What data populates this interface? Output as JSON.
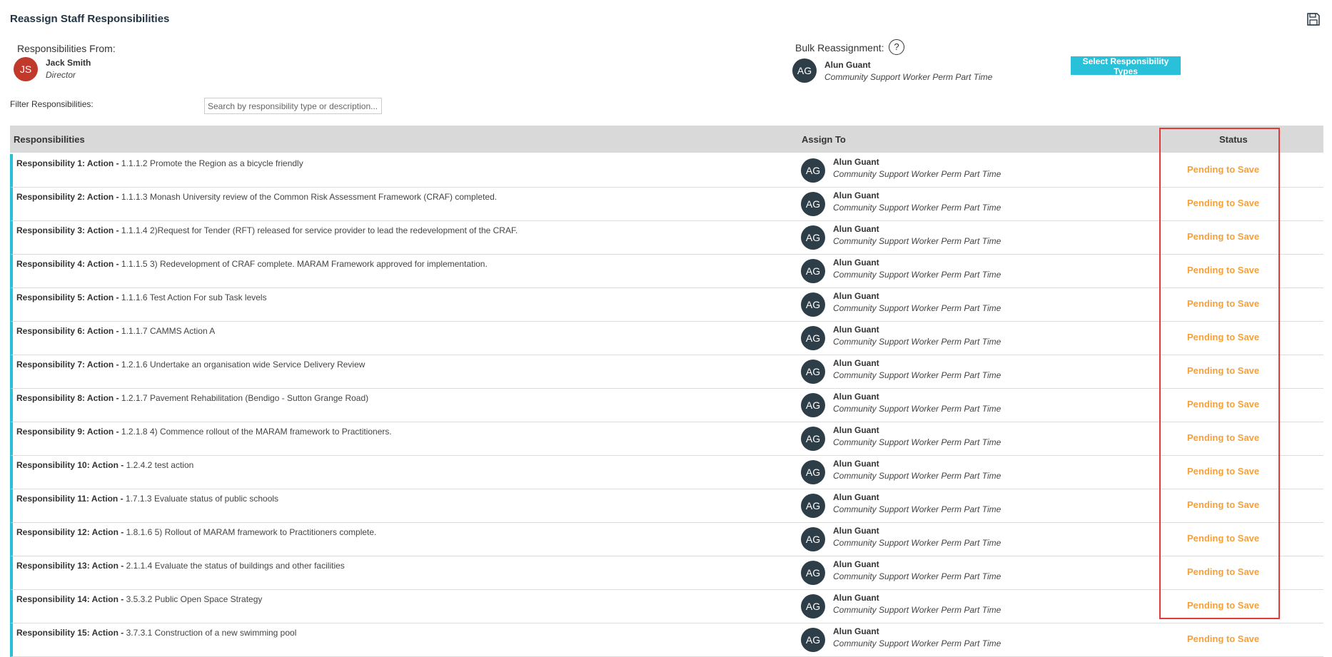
{
  "page": {
    "title": "Reassign Staff Responsibilities"
  },
  "from": {
    "label": "Responsibilities From:",
    "initials": "JS",
    "name": "Jack Smith",
    "role": "Director"
  },
  "bulk": {
    "label": "Bulk Reassignment:",
    "help": "?",
    "initials": "AG",
    "name": "Alun Guant",
    "role": "Community Support Worker Perm Part Time",
    "button_label": "Select Responsibility Types"
  },
  "filter": {
    "label": "Filter Responsibilities:",
    "placeholder": "Search by responsibility type or description..."
  },
  "table": {
    "headers": {
      "responsibilities": "Responsibilities",
      "assign_to": "Assign To",
      "status": "Status"
    },
    "rows": [
      {
        "prefix": "Responsibility 1: Action -",
        "text": " 1.1.1.2 Promote the Region as a bicycle friendly",
        "initials": "AG",
        "name": "Alun Guant",
        "role": "Community Support Worker Perm Part Time",
        "status": "Pending to Save"
      },
      {
        "prefix": "Responsibility 2: Action -",
        "text": " 1.1.1.3 Monash University review of the Common Risk Assessment Framework (CRAF) completed.",
        "initials": "AG",
        "name": "Alun Guant",
        "role": "Community Support Worker Perm Part Time",
        "status": "Pending to Save"
      },
      {
        "prefix": "Responsibility 3: Action -",
        "text": " 1.1.1.4 2)Request for Tender (RFT) released for service provider to lead the redevelopment of the CRAF.",
        "initials": "AG",
        "name": "Alun Guant",
        "role": "Community Support Worker Perm Part Time",
        "status": "Pending to Save"
      },
      {
        "prefix": "Responsibility 4: Action -",
        "text": " 1.1.1.5 3) Redevelopment of CRAF complete. MARAM Framework approved for implementation.",
        "initials": "AG",
        "name": "Alun Guant",
        "role": "Community Support Worker Perm Part Time",
        "status": "Pending to Save"
      },
      {
        "prefix": "Responsibility 5: Action -",
        "text": " 1.1.1.6 Test Action For sub Task levels",
        "initials": "AG",
        "name": "Alun Guant",
        "role": "Community Support Worker Perm Part Time",
        "status": "Pending to Save"
      },
      {
        "prefix": "Responsibility 6: Action -",
        "text": " 1.1.1.7 CAMMS Action A",
        "initials": "AG",
        "name": "Alun Guant",
        "role": "Community Support Worker Perm Part Time",
        "status": "Pending to Save"
      },
      {
        "prefix": "Responsibility 7: Action -",
        "text": " 1.2.1.6 Undertake an organisation wide Service Delivery Review",
        "initials": "AG",
        "name": "Alun Guant",
        "role": "Community Support Worker Perm Part Time",
        "status": "Pending to Save"
      },
      {
        "prefix": "Responsibility 8: Action -",
        "text": " 1.2.1.7 Pavement Rehabilitation (Bendigo - Sutton Grange Road)",
        "initials": "AG",
        "name": "Alun Guant",
        "role": "Community Support Worker Perm Part Time",
        "status": "Pending to Save"
      },
      {
        "prefix": "Responsibility 9: Action -",
        "text": " 1.2.1.8 4) Commence rollout of the MARAM framework to Practitioners.",
        "initials": "AG",
        "name": "Alun Guant",
        "role": "Community Support Worker Perm Part Time",
        "status": "Pending to Save"
      },
      {
        "prefix": "Responsibility 10: Action -",
        "text": " 1.2.4.2 test action",
        "initials": "AG",
        "name": "Alun Guant",
        "role": "Community Support Worker Perm Part Time",
        "status": "Pending to Save"
      },
      {
        "prefix": "Responsibility 11: Action -",
        "text": " 1.7.1.3 Evaluate status of public schools",
        "initials": "AG",
        "name": "Alun Guant",
        "role": "Community Support Worker Perm Part Time",
        "status": "Pending to Save"
      },
      {
        "prefix": "Responsibility 12: Action -",
        "text": " 1.8.1.6 5) Rollout of MARAM framework to Practitioners complete.",
        "initials": "AG",
        "name": "Alun Guant",
        "role": "Community Support Worker Perm Part Time",
        "status": "Pending to Save"
      },
      {
        "prefix": "Responsibility 13: Action -",
        "text": " 2.1.1.4 Evaluate the status of buildings and other facilities",
        "initials": "AG",
        "name": "Alun Guant",
        "role": "Community Support Worker Perm Part Time",
        "status": "Pending to Save"
      },
      {
        "prefix": "Responsibility 14: Action -",
        "text": " 3.5.3.2 Public Open Space Strategy",
        "initials": "AG",
        "name": "Alun Guant",
        "role": "Community Support Worker Perm Part Time",
        "status": "Pending to Save"
      },
      {
        "prefix": "Responsibility 15: Action -",
        "text": " 3.7.3.1 Construction of a new swimming pool",
        "initials": "AG",
        "name": "Alun Guant",
        "role": "Community Support Worker Perm Part Time",
        "status": "Pending to Save"
      }
    ]
  },
  "colors": {
    "accent": "#29c1d9",
    "pending": "#f5a03a",
    "highlight": "#e03a3a",
    "avatar_dark": "#2e3e48",
    "avatar_red": "#c0392b"
  }
}
